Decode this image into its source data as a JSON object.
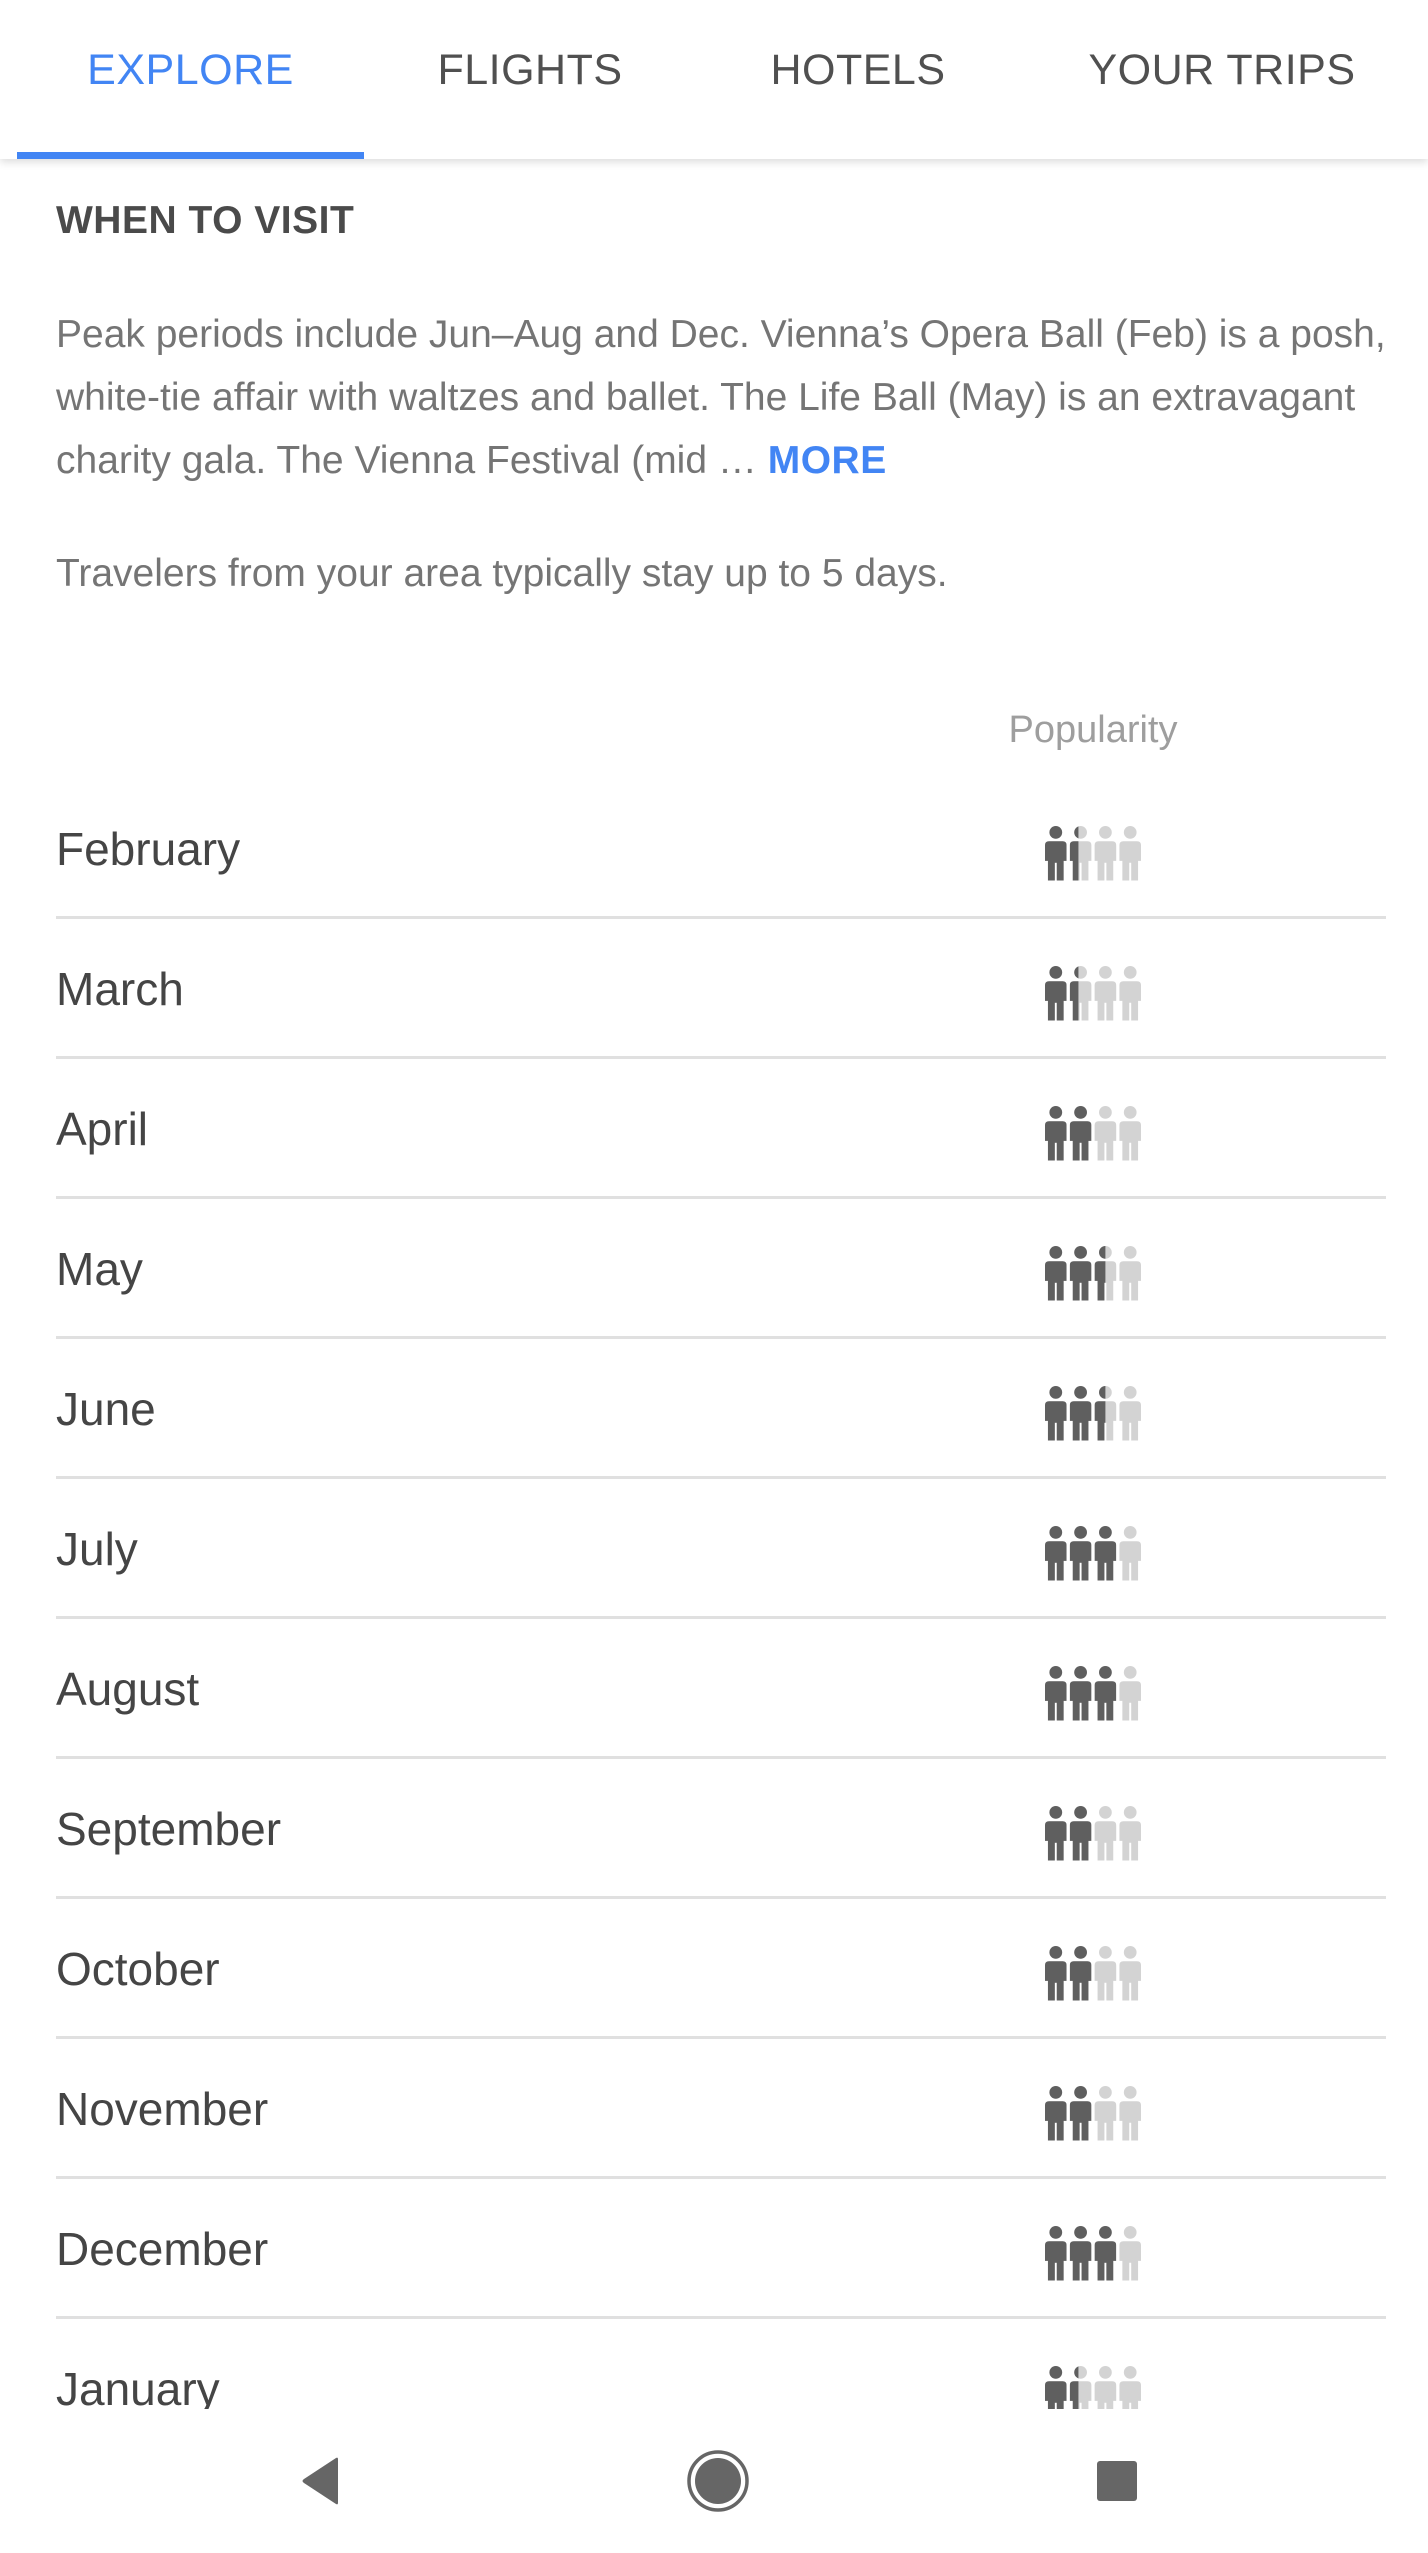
{
  "tabs": [
    {
      "label": "EXPLORE",
      "active": true
    },
    {
      "label": "FLIGHTS",
      "active": false
    },
    {
      "label": "HOTELS",
      "active": false
    },
    {
      "label": "YOUR TRIPS",
      "active": false
    }
  ],
  "colors": {
    "accent": "#4285f4",
    "icon_filled": "#5f5f5f",
    "icon_empty": "#d3d3d3",
    "divider": "#e0e0e0"
  },
  "when_to_visit": {
    "title": "WHEN TO VISIT",
    "description": "Peak periods include Jun–Aug and Dec. Vienna’s Opera Ball (Feb) is a posh, white-tie affair with waltzes and ballet. The Life Ball (May) is an extravagant charity gala. The Vienna Festival (mid …",
    "more_label": "MORE",
    "stay_note": "Travelers from your area typically stay up to 5 days.",
    "popularity_header": "Popularity",
    "popularity_max": 4,
    "months": [
      {
        "name": "February",
        "popularity": 1.4
      },
      {
        "name": "March",
        "popularity": 1.4
      },
      {
        "name": "April",
        "popularity": 2
      },
      {
        "name": "May",
        "popularity": 2.5
      },
      {
        "name": "June",
        "popularity": 2.5
      },
      {
        "name": "July",
        "popularity": 3
      },
      {
        "name": "August",
        "popularity": 3
      },
      {
        "name": "September",
        "popularity": 2
      },
      {
        "name": "October",
        "popularity": 2
      },
      {
        "name": "November",
        "popularity": 2
      },
      {
        "name": "December",
        "popularity": 3
      },
      {
        "name": "January",
        "popularity": 1.4
      }
    ]
  },
  "system_nav": {
    "back_icon": "back-triangle-icon",
    "home_icon": "home-circle-icon",
    "recents_icon": "recents-square-icon"
  }
}
